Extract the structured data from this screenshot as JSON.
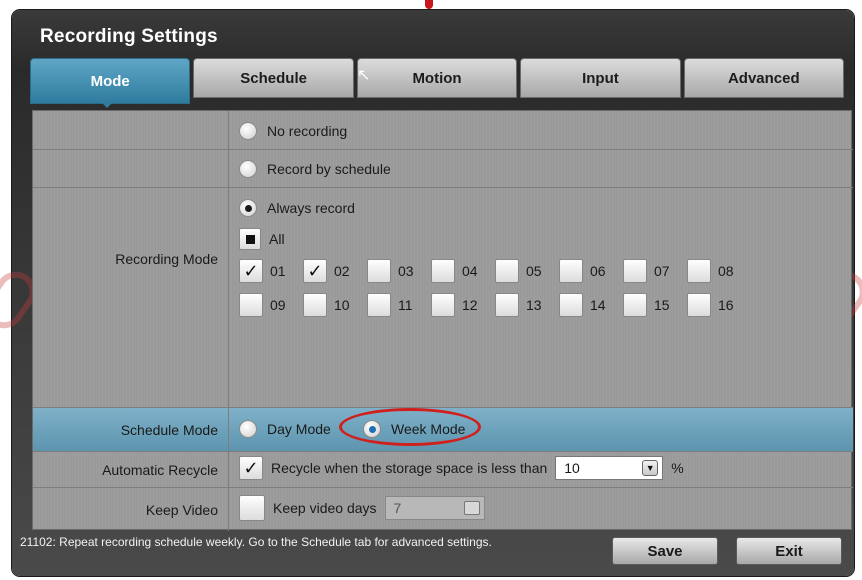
{
  "window": {
    "title": "Recording Settings"
  },
  "tabs": [
    {
      "label": "Mode",
      "active": true
    },
    {
      "label": "Schedule",
      "active": false
    },
    {
      "label": "Motion",
      "active": false
    },
    {
      "label": "Input",
      "active": false
    },
    {
      "label": "Advanced",
      "active": false
    }
  ],
  "recording_mode": {
    "label": "Recording Mode",
    "options": [
      {
        "label": "No recording",
        "selected": false
      },
      {
        "label": "Record by schedule",
        "selected": false
      },
      {
        "label": "Always record",
        "selected": true
      }
    ],
    "all_label": "All",
    "channels": [
      {
        "label": "01",
        "checked": true
      },
      {
        "label": "02",
        "checked": true
      },
      {
        "label": "03",
        "checked": false
      },
      {
        "label": "04",
        "checked": false
      },
      {
        "label": "05",
        "checked": false
      },
      {
        "label": "06",
        "checked": false
      },
      {
        "label": "07",
        "checked": false
      },
      {
        "label": "08",
        "checked": false
      },
      {
        "label": "09",
        "checked": false
      },
      {
        "label": "10",
        "checked": false
      },
      {
        "label": "11",
        "checked": false
      },
      {
        "label": "12",
        "checked": false
      },
      {
        "label": "13",
        "checked": false
      },
      {
        "label": "14",
        "checked": false
      },
      {
        "label": "15",
        "checked": false
      },
      {
        "label": "16",
        "checked": false
      }
    ]
  },
  "schedule_mode": {
    "label": "Schedule Mode",
    "day_label": "Day Mode",
    "week_label": "Week Mode",
    "selected": "week"
  },
  "automatic_recycle": {
    "label": "Automatic Recycle",
    "checkbox_label": "Recycle when the storage space is less than",
    "checked": true,
    "value": "10",
    "unit": "%"
  },
  "keep_video": {
    "label": "Keep Video",
    "checkbox_label": "Keep video days",
    "checked": false,
    "value": "7"
  },
  "footer": {
    "message": "21102: Repeat recording schedule weekly.  Go to the Schedule tab for advanced settings.",
    "save_label": "Save",
    "exit_label": "Exit"
  },
  "colors": {
    "active_tab": "#2f7c9e",
    "highlight_row": "#6aa3bd",
    "annotation": "#d0201e",
    "panel": "#9a9a9a"
  }
}
